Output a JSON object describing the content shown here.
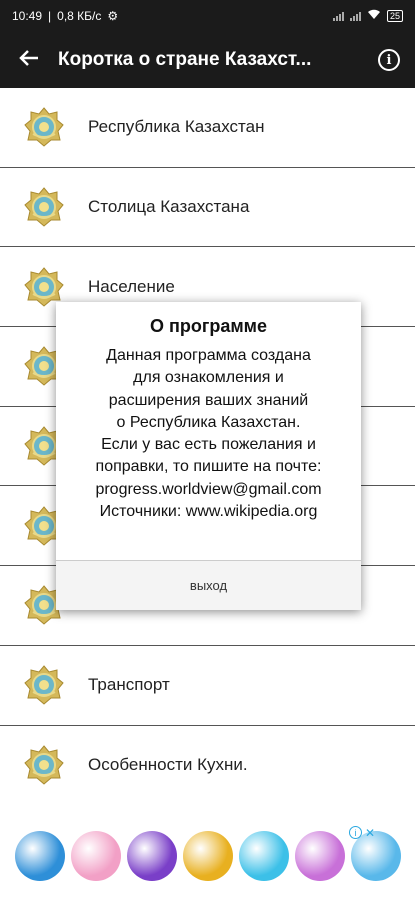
{
  "status_bar": {
    "time": "10:49",
    "speed": "0,8 КБ/с",
    "battery": "25"
  },
  "app_bar": {
    "title": "Коротка о стране Казахст..."
  },
  "list": {
    "items": [
      {
        "label": "Республика Казахстан"
      },
      {
        "label": "Столица Казахстана"
      },
      {
        "label": "Население"
      },
      {
        "label": ""
      },
      {
        "label": ""
      },
      {
        "label": ""
      },
      {
        "label": ""
      },
      {
        "label": "Транспорт"
      },
      {
        "label": "Особенности Кухни."
      }
    ]
  },
  "dialog": {
    "title": "О программе",
    "lines": [
      "Данная программа создана",
      "для ознакомления и",
      "расширения ваших знаний",
      "о Республика Казахстан.",
      "Если у вас есть пожелания и",
      "поправки, то пишите на почте:",
      "progress.worldview@gmail.com",
      "Источники: www.wikipedia.org"
    ],
    "button": "выход"
  },
  "ad_banner": {
    "thumb_colors": [
      "#2e8fd8",
      "#f2a0c6",
      "#7a3fc8",
      "#e8b020",
      "#3cc0e8",
      "#c870d8",
      "#59b8ea"
    ]
  }
}
